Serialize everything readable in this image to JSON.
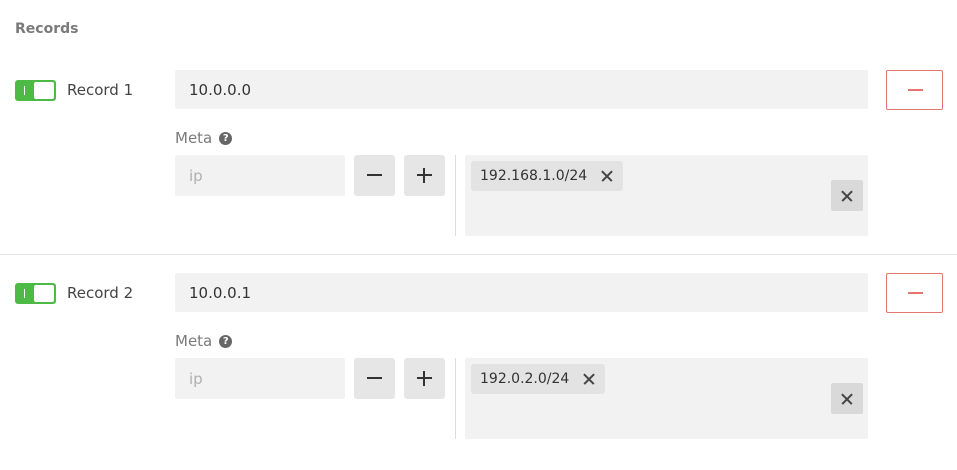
{
  "section": {
    "title": "Records"
  },
  "records": [
    {
      "enabled": true,
      "label": "Record 1",
      "value": "10.0.0.0",
      "meta": {
        "label": "Meta",
        "help_icon": "question-circle-icon",
        "ip_placeholder": "ip",
        "tags": [
          "192.168.1.0/24"
        ]
      }
    },
    {
      "enabled": true,
      "label": "Record 2",
      "value": "10.0.0.1",
      "meta": {
        "label": "Meta",
        "help_icon": "question-circle-icon",
        "ip_placeholder": "ip",
        "tags": [
          "192.0.2.0/24"
        ]
      }
    }
  ],
  "colors": {
    "toggle_on": "#4cba45",
    "danger": "#e4766f",
    "field_bg": "#f2f2f2",
    "section_title": "#7a7a7a"
  }
}
